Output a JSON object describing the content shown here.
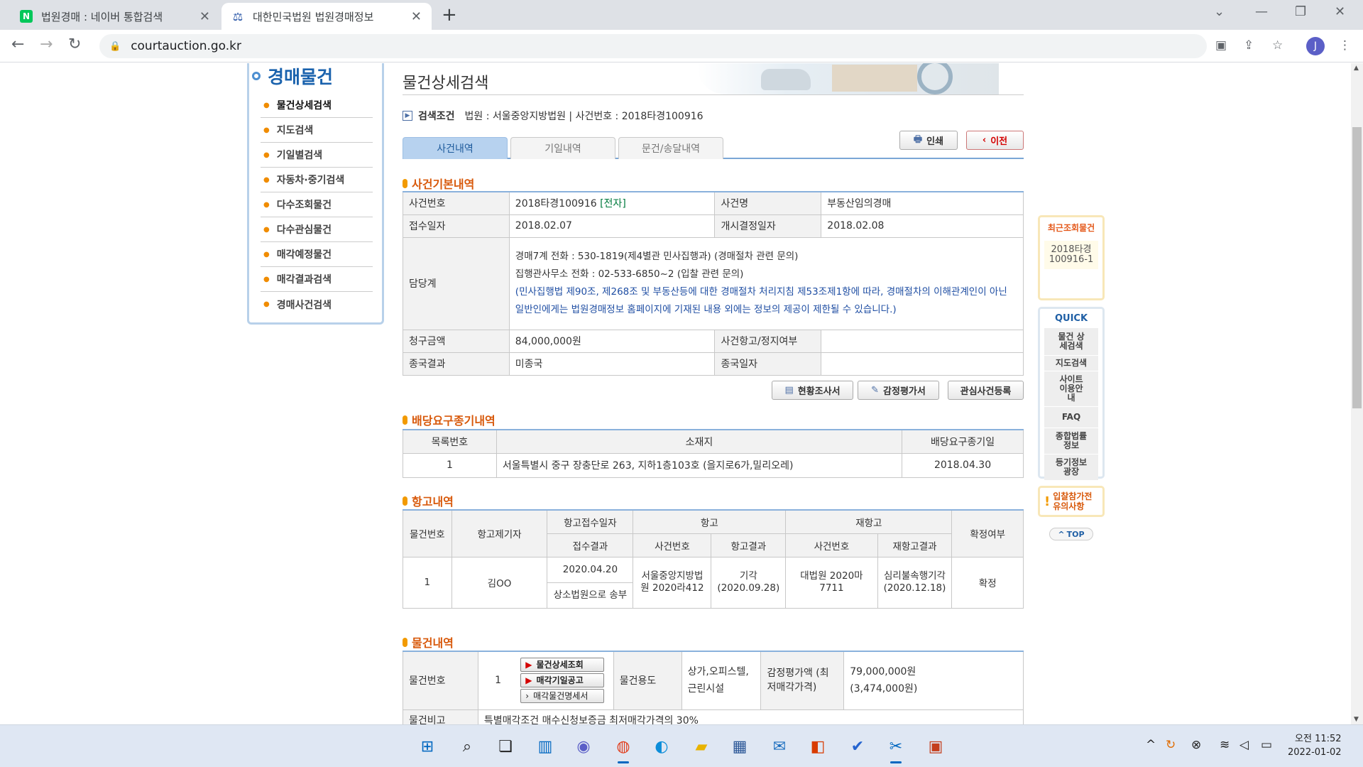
{
  "browser": {
    "tabs": [
      {
        "title": "법원경매 : 네이버 통합검색",
        "favicon_text": "N",
        "favicon_color": "#03c75a"
      },
      {
        "title": "대한민국법원 법원경매정보",
        "favicon_text": "⚖",
        "favicon_color": "#1f4ea3"
      }
    ],
    "url": "courtauction.go.kr",
    "profile_initial": "J"
  },
  "leftmenu": {
    "title": "경매물건",
    "items": [
      "물건상세검색",
      "지도검색",
      "기일별검색",
      "자동차·중기검색",
      "다수조회물건",
      "다수관심물건",
      "매각예정물건",
      "매각결과검색",
      "경매사건검색"
    ]
  },
  "main": {
    "page_title": "물건상세검색",
    "search_label": "검색조건",
    "search_value": "법원 : 서울중앙지방법원 | 사건번호 : 2018타경100916",
    "tabs": [
      "사건내역",
      "기일내역",
      "문건/송달내역"
    ],
    "print_label": "인쇄",
    "prev_label": "이전"
  },
  "basic": {
    "section_title": "사건기본내역",
    "case_no_label": "사건번호",
    "case_no": "2018타경100916",
    "case_tag": "[전자]",
    "case_name_label": "사건명",
    "case_name": "부동산임의경매",
    "receipt_label": "접수일자",
    "receipt": "2018.02.07",
    "start_label": "개시결정일자",
    "start": "2018.02.08",
    "dept_label": "담당계",
    "dept_line1": "경매7계    전화 : 530-1819(제4별관 민사집행과) (경매절차 관련 문의)",
    "dept_line2": "집행관사무소    전화 : 02-533-6850~2 (입찰 관련 문의)",
    "dept_notice": "(민사집행법 제90조, 제268조 및 부동산등에 대한 경매절차 처리지침 제53조제1항에 따라, 경매절차의 이해관계인이 아닌 일반인에게는 법원경매정보 홈페이지에 기재된 내용 외에는 정보의 제공이 제한될 수 있습니다.)",
    "claim_label": "청구금액",
    "claim": "84,000,000원",
    "appeal_stop_label": "사건항고/정지여부",
    "appeal_stop": "",
    "final_label": "종국결과",
    "final": "미종국",
    "final_date_label": "종국일자",
    "final_date": "",
    "btn_status": "현황조사서",
    "btn_appraisal": "감정평가서",
    "btn_interest": "관심사건등록"
  },
  "dividend": {
    "section_title": "배당요구종기내역",
    "headers": [
      "목록번호",
      "소재지",
      "배당요구종기일"
    ],
    "rows": [
      [
        "1",
        "서울특별시 중구 장충단로 263, 지하1층103호 (을지로6가,밀리오레)",
        "2018.04.30"
      ]
    ]
  },
  "appeal": {
    "section_title": "항고내역",
    "h_item": "물건번호",
    "h_filer": "항고제기자",
    "h_recv": "항고접수일자",
    "h_appeal": "항고",
    "h_reappeal": "재항고",
    "h_confirm": "확정여부",
    "h_recv_result": "접수결과",
    "h_case_no": "사건번호",
    "h_appeal_result": "항고결과",
    "h_re_case_no": "사건번호",
    "h_reappeal_result": "재항고결과",
    "item": "1",
    "filer": "김OO",
    "recv_date": "2020.04.20",
    "recv_result": "상소법원으로 송부",
    "case_no": "서울중앙지방법원 2020라412",
    "appeal_result": "기각 (2020.09.28)",
    "re_case_no": "대법원 2020마7711",
    "reappeal_result": "심리불속행기각 (2020.12.18)",
    "confirm": "확정"
  },
  "goods": {
    "section_title": "물건내역",
    "item_label": "물건번호",
    "item": "1",
    "btn_detail": "물건상세조회",
    "btn_notice": "매각기일공고",
    "btn_spec": "매각물건명세서",
    "use_label": "물건용도",
    "use": "상가,오피스텔, 근린시설",
    "appraisal_label": "감정평가액 (최저매각가격)",
    "appraisal": "79,000,000원",
    "min_price": "(3,474,000원)",
    "note_label": "물건비고",
    "note": "특별매각조건 매수신청보증금 최저매각가격의 30%"
  },
  "quick": {
    "recent_title": "최근조회물건",
    "recent_item": "2018타경100916-1",
    "quick_title": "QUICK",
    "items": [
      "물건 상세검색",
      "지도검색",
      "사이트 이용안내",
      "FAQ",
      "종합법률 정보",
      "등기정보 광장"
    ],
    "notice": "입찰참가전 유의사항",
    "top": "TOP"
  },
  "taskbar": {
    "time": "오전 11:52",
    "date": "2022-01-02"
  }
}
